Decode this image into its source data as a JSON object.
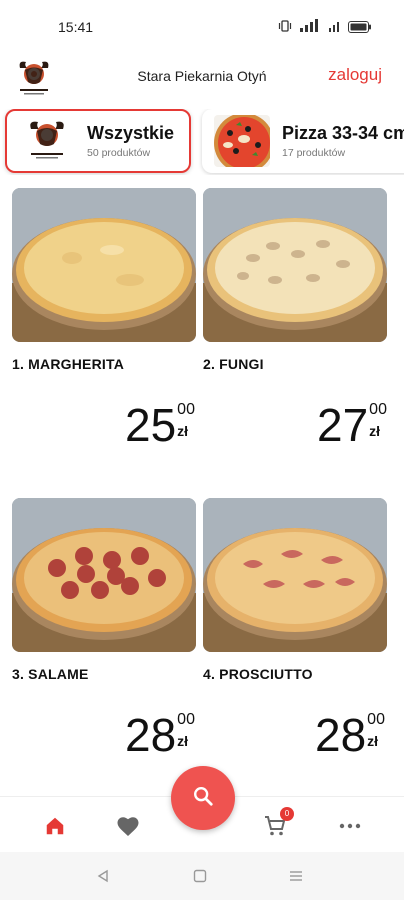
{
  "status_bar": {
    "time": "15:41",
    "icons": [
      "vibrate-icon",
      "signal-icon",
      "wifi-icon",
      "battery-icon"
    ]
  },
  "header": {
    "title": "Stara Piekarnia Otyń",
    "login_label": "zaloguj",
    "logo_icon": "bull-logo-icon"
  },
  "categories": [
    {
      "name": "Wszystkie",
      "count": "50 produktów",
      "active": true
    },
    {
      "name": "Pizza 33-34 cm",
      "count": "17 produktów",
      "active": false
    }
  ],
  "products": [
    {
      "name": "1. MARGHERITA",
      "price_main": "25",
      "price_cents": "00",
      "currency": "zł"
    },
    {
      "name": "2. FUNGI",
      "price_main": "27",
      "price_cents": "00",
      "currency": "zł"
    },
    {
      "name": "3. SALAME",
      "price_main": "28",
      "price_cents": "00",
      "currency": "zł"
    },
    {
      "name": "4. PROSCIUTTO",
      "price_main": "28",
      "price_cents": "00",
      "currency": "zł"
    }
  ],
  "bottom_nav": {
    "items": [
      "home-icon",
      "heart-icon",
      "search-icon",
      "cart-icon",
      "more-icon"
    ],
    "cart_count": "0"
  },
  "colors": {
    "accent": "#e53935",
    "fab": "#ef5350"
  }
}
